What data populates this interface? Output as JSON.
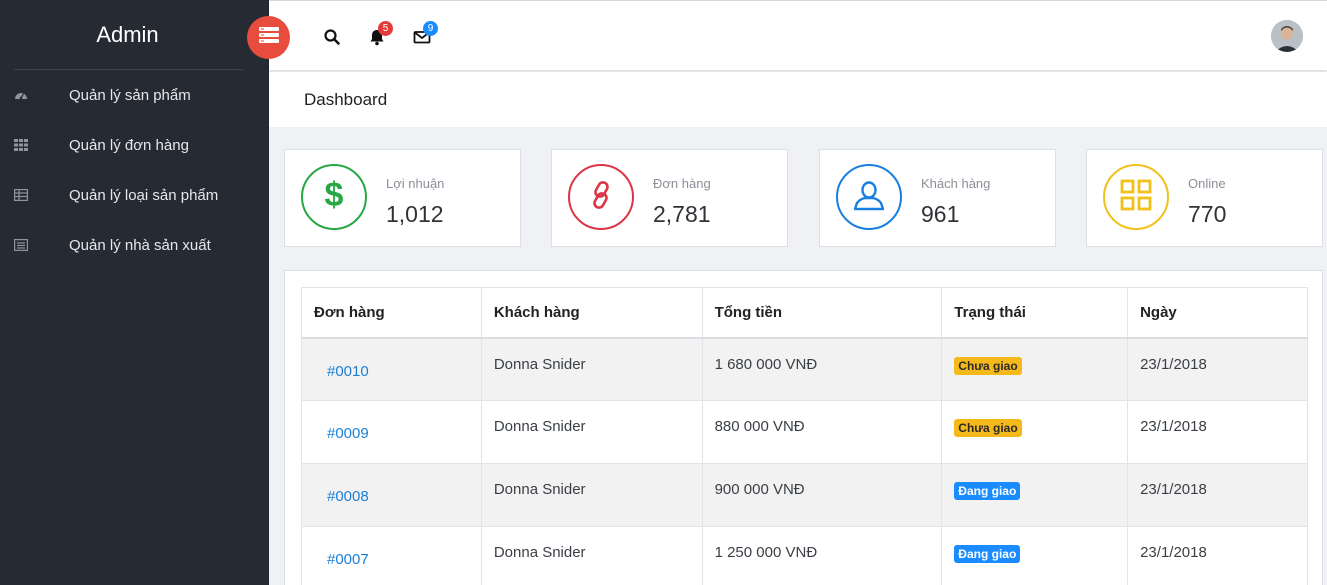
{
  "sidebar": {
    "brand": "Admin",
    "items": [
      {
        "label": "Quản lý sản phẩm",
        "icon": "dashboard-gauge-icon"
      },
      {
        "label": "Quản lý đơn hàng",
        "icon": "grid-icon"
      },
      {
        "label": "Quản lý loại sản phẩm",
        "icon": "table-icon"
      },
      {
        "label": "Quản lý nhà sản xuất",
        "icon": "list-icon"
      }
    ]
  },
  "topbar": {
    "notification_count": "5",
    "message_count": "9"
  },
  "page": {
    "title": "Dashboard"
  },
  "stats": [
    {
      "label": "Lợi nhuận",
      "value": "1,012",
      "color": "#28a745",
      "icon": "dollar-icon"
    },
    {
      "label": "Đơn hàng",
      "value": "2,781",
      "color": "#dc3545",
      "icon": "link-icon"
    },
    {
      "label": "Khách hàng",
      "value": "961",
      "color": "#1a7fe0",
      "icon": "user-icon"
    },
    {
      "label": "Online",
      "value": "770",
      "color": "#f2c01b",
      "icon": "apps-grid-icon"
    }
  ],
  "orders": {
    "headers": [
      "Đơn hàng",
      "Khách hàng",
      "Tổng tiền",
      "Trạng thái",
      "Ngày"
    ],
    "rows": [
      {
        "id": "#0010",
        "customer": "Donna Snider",
        "total": "1 680 000 VNĐ",
        "status": "Chưa giao",
        "status_type": "pending",
        "date": "23/1/2018"
      },
      {
        "id": "#0009",
        "customer": "Donna Snider",
        "total": "880 000 VNĐ",
        "status": "Chưa giao",
        "status_type": "pending",
        "date": "23/1/2018"
      },
      {
        "id": "#0008",
        "customer": "Donna Snider",
        "total": "900 000 VNĐ",
        "status": "Đang giao",
        "status_type": "shipping",
        "date": "23/1/2018"
      },
      {
        "id": "#0007",
        "customer": "Donna Snider",
        "total": "1 250 000 VNĐ",
        "status": "Đang giao",
        "status_type": "shipping",
        "date": "23/1/2018"
      }
    ]
  }
}
